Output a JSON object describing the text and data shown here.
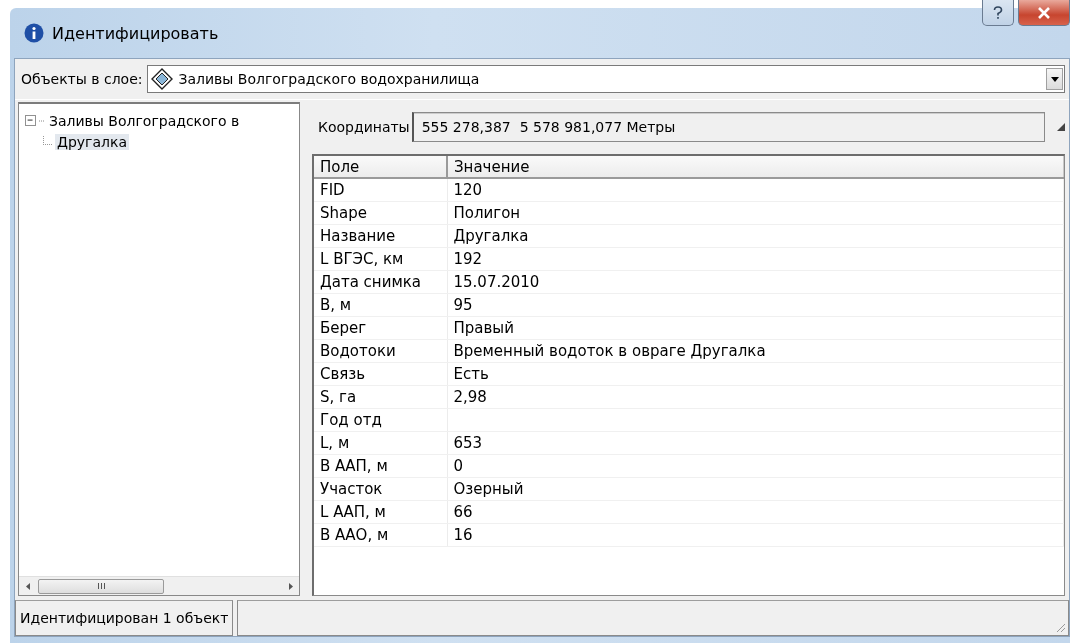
{
  "window": {
    "title": "Идентифицировать"
  },
  "layer": {
    "label": "Объекты в слое:",
    "value": "Заливы Волгоградского водохранилища"
  },
  "tree": [
    {
      "label": "Заливы Волгоградского в",
      "expanded": true,
      "selected": false,
      "children": [
        {
          "label": "Другалка",
          "selected": true
        }
      ]
    }
  ],
  "coordinates": {
    "label": "Координаты",
    "value": "555 278,387  5 578 981,077 Метры"
  },
  "table": {
    "columns": [
      "Поле",
      "Значение"
    ],
    "rows": [
      [
        "FID",
        "120"
      ],
      [
        "Shape",
        "Полигон"
      ],
      [
        "Название",
        "Другалка"
      ],
      [
        "L ВГЭС, км",
        "192"
      ],
      [
        "Дата снимка",
        "15.07.2010"
      ],
      [
        "B, м",
        "95"
      ],
      [
        "Берег",
        "Правый"
      ],
      [
        "Водотоки",
        "Временный водоток в овраге Другалка"
      ],
      [
        "Связь",
        "Есть"
      ],
      [
        "S, га",
        "2,98"
      ],
      [
        "Год отд",
        ""
      ],
      [
        "L, м",
        "653"
      ],
      [
        "B ААП, м",
        "0"
      ],
      [
        "Участок",
        "Озерный"
      ],
      [
        "L ААП, м",
        "66"
      ],
      [
        "B ААО, м",
        "16"
      ]
    ]
  },
  "status_bar": {
    "text": "Идентифицирован 1 объект"
  }
}
